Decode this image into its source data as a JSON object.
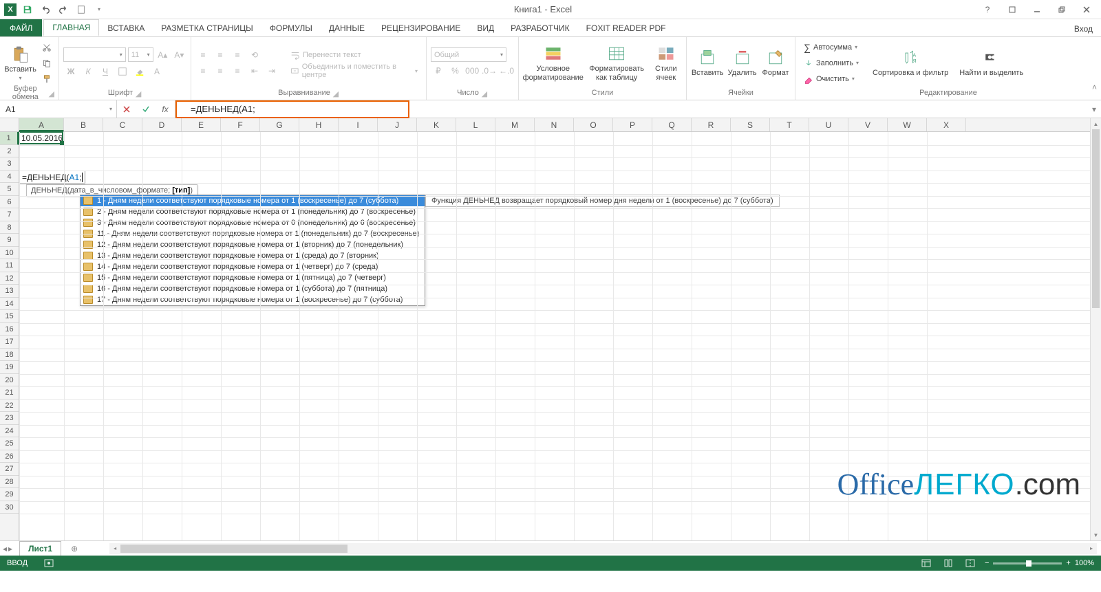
{
  "title": "Книга1 - Excel",
  "login": "Вход",
  "tabs": {
    "file": "ФАЙЛ",
    "items": [
      "ГЛАВНАЯ",
      "ВСТАВКА",
      "РАЗМЕТКА СТРАНИЦЫ",
      "ФОРМУЛЫ",
      "ДАННЫЕ",
      "РЕЦЕНЗИРОВАНИЕ",
      "ВИД",
      "РАЗРАБОТЧИК",
      "FOXIT READER PDF"
    ],
    "active": 0
  },
  "ribbon": {
    "clipboard": {
      "label": "Буфер обмена",
      "paste": "Вставить"
    },
    "font": {
      "label": "Шрифт",
      "name": "",
      "size": "11"
    },
    "align": {
      "label": "Выравнивание",
      "wrap": "Перенести текст",
      "merge": "Объединить и поместить в центре"
    },
    "number": {
      "label": "Число",
      "format": "Общий"
    },
    "styles": {
      "label": "Стили",
      "cond": "Условное форматирование",
      "table": "Форматировать как таблицу",
      "cell": "Стили ячеек"
    },
    "cells": {
      "label": "Ячейки",
      "insert": "Вставить",
      "delete": "Удалить",
      "format": "Формат"
    },
    "editing": {
      "label": "Редактирование",
      "sum": "Автосумма",
      "fill": "Заполнить",
      "clear": "Очистить",
      "sort": "Сортировка и фильтр",
      "find": "Найти и выделить"
    }
  },
  "namebox": "A1",
  "formula": "=ДЕНЬНЕД(A1;",
  "cellA1": "10.05.2016",
  "editing_cell_row": 4,
  "editing_cell": {
    "prefix": "=ДЕНЬНЕД(",
    "ref": "A1",
    "suffix": ";"
  },
  "sig_tooltip": {
    "fn": "ДЕНЬНЕД",
    "args": "(дата_в_числовом_формате; ",
    "bold": "[тип]",
    "close": ")"
  },
  "dropdown_items": [
    "1 - Дням недели соответствуют порядковые номера от 1 (воскресенье) до 7 (суббота)",
    "2 - Дням недели соответствуют порядковые номера от 1 (понедельник) до 7 (воскресенье)",
    "3 - Дням недели соответствуют порядковые номера от 0 (понедельник) до 6 (воскресенье)",
    "11 - Дням недели соответствуют порядковые номера от 1 (понедельник) до 7 (воскресенье)",
    "12 - Дням недели соответствуют порядковые номера от 1 (вторник) до 7 (понедельник)",
    "13 - Дням недели соответствуют порядковые номера от 1 (среда) до 7 (вторник)",
    "14 - Дням недели соответствуют порядковые номера от 1 (четверг) до 7 (среда)",
    "15 - Дням недели соответствуют порядковые номера от 1 (пятница) до 7 (четверг)",
    "16 - Дням недели соответствуют порядковые номера от 1 (суббота) до 7 (пятница)",
    "17 - Дням недели соответствуют порядковые номера от 1 (воскресенье) до 7 (суббота)"
  ],
  "dropdown_selected": 0,
  "desc_tip": "Функция ДЕНЬНЕД возвращает порядковый номер дня недели от 1 (воскресенье) до 7 (суббота)",
  "columns": [
    "A",
    "B",
    "C",
    "D",
    "E",
    "F",
    "G",
    "H",
    "I",
    "J",
    "K",
    "L",
    "M",
    "N",
    "O",
    "P",
    "Q",
    "R",
    "S",
    "T",
    "U",
    "V",
    "W",
    "X"
  ],
  "rows": 30,
  "sheet": "Лист1",
  "status": "ВВОД",
  "zoom": "100%",
  "watermark": {
    "brand1": "Office",
    "brand2": "ЛЕГКО",
    "brand3": ".com"
  }
}
